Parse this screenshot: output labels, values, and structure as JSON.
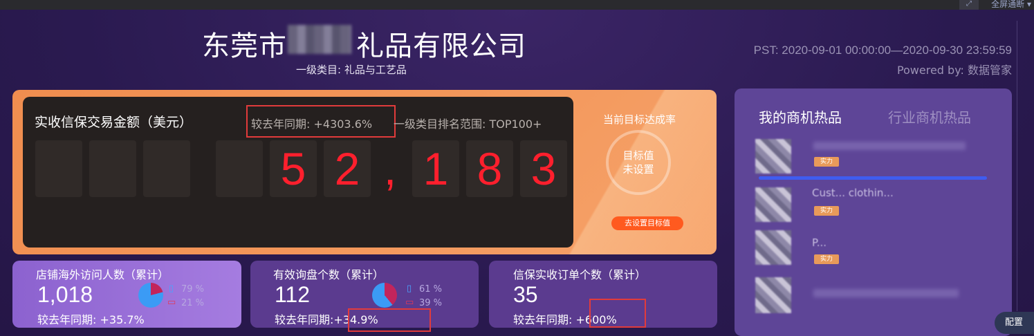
{
  "topbar": {
    "expand_icon": "expand-icon",
    "fullscreen_label": "全屏通断 ▾"
  },
  "header": {
    "company_title_prefix": "东莞市",
    "company_title_suffix": "礼品有限公司",
    "category": "一级类目: 礼品与工艺品",
    "period": "PST: 2020-09-01 00:00:00—2020-09-30 23:59:59",
    "powered_by": "Powered by: 数据管家"
  },
  "main": {
    "title": "实收信保交易金额（美元）",
    "yoy": "较去年同期: +4303.6%",
    "rank": "一级类目排名范围: TOP100+",
    "digits": [
      "",
      "",
      "",
      "",
      "5",
      "2",
      ",",
      "1",
      "8",
      "3"
    ],
    "goal_title": "当前目标达成率",
    "goal_line1": "目标值",
    "goal_line2": "未设置",
    "goal_button": "去设置目标值"
  },
  "cards": [
    {
      "title": "店铺海外访问人数（累计）",
      "value": "1,018",
      "yoy_label": "较去年同期:",
      "yoy_value": "+35.7%",
      "mobile_pct": "79 %",
      "pc_pct": "21 %"
    },
    {
      "title": "有效询盘个数（累计）",
      "value": "112",
      "yoy_label": "较去年同期:",
      "yoy_value": "+34.9%",
      "mobile_pct": "61 %",
      "pc_pct": "39 %"
    },
    {
      "title": "信保实收订单个数（累计）",
      "value": "35",
      "yoy_label": "较去年同期:",
      "yoy_value": "+600%"
    }
  ],
  "right_panel": {
    "tab_active": "我的商机热品",
    "tab_inactive": "行业商机热品",
    "items": [
      {
        "tag": "实力",
        "text": ""
      },
      {
        "tag": "实力",
        "text": "Cust... clothin..."
      },
      {
        "tag": "实力",
        "text": "P..."
      },
      {
        "tag": "",
        "text": ""
      }
    ]
  },
  "config_label": "配置",
  "colors": {
    "digit_red": "#ff1f2d",
    "accent_orange": "#f39659",
    "highlight_box": "#e23b3b"
  }
}
